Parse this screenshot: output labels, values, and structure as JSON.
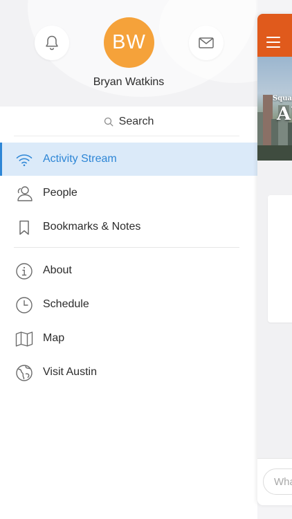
{
  "colors": {
    "accent": "#2d86d6",
    "active_bg": "#dbeaf9",
    "avatar_bg": "#f5a23a",
    "topbar": "#e05a1c"
  },
  "header": {
    "avatar_initials": "BW",
    "user_name": "Bryan Watkins",
    "notifications_icon": "bell-icon",
    "messages_icon": "mail-icon"
  },
  "search": {
    "label": "Search",
    "icon": "search-icon"
  },
  "menu": {
    "primary": [
      {
        "label": "Activity Stream",
        "icon": "wifi-icon",
        "active": true
      },
      {
        "label": "People",
        "icon": "person-icon",
        "active": false
      },
      {
        "label": "Bookmarks & Notes",
        "icon": "bookmark-icon",
        "active": false
      }
    ],
    "secondary": [
      {
        "label": "About",
        "icon": "info-icon"
      },
      {
        "label": "Schedule",
        "icon": "clock-icon"
      },
      {
        "label": "Map",
        "icon": "map-icon"
      },
      {
        "label": "Visit Austin",
        "icon": "globe-icon"
      }
    ]
  },
  "main": {
    "menu_icon": "hamburger-icon",
    "banner_line1": "Squar",
    "banner_line2": "AU",
    "compose_placeholder": "Wha"
  }
}
